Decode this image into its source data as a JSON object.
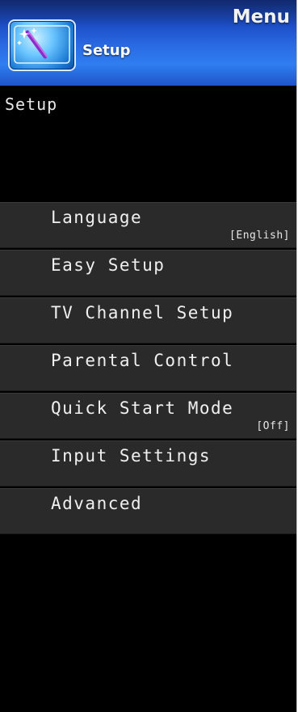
{
  "header": {
    "menu_label": "Menu",
    "title": "Setup",
    "icon": "setup-wand-icon"
  },
  "section": {
    "title": "Setup"
  },
  "menu": {
    "items": [
      {
        "label": "Language",
        "value": "[English]"
      },
      {
        "label": "Easy Setup",
        "value": ""
      },
      {
        "label": "TV Channel Setup",
        "value": ""
      },
      {
        "label": "Parental Control",
        "value": ""
      },
      {
        "label": "Quick Start Mode",
        "value": "[Off]"
      },
      {
        "label": "Input Settings",
        "value": ""
      },
      {
        "label": "Advanced",
        "value": ""
      }
    ]
  },
  "colors": {
    "header_blue": "#2f7ef0",
    "background": "#000000",
    "item_background": "#2a2a2a",
    "text": "#f0f0f0"
  }
}
